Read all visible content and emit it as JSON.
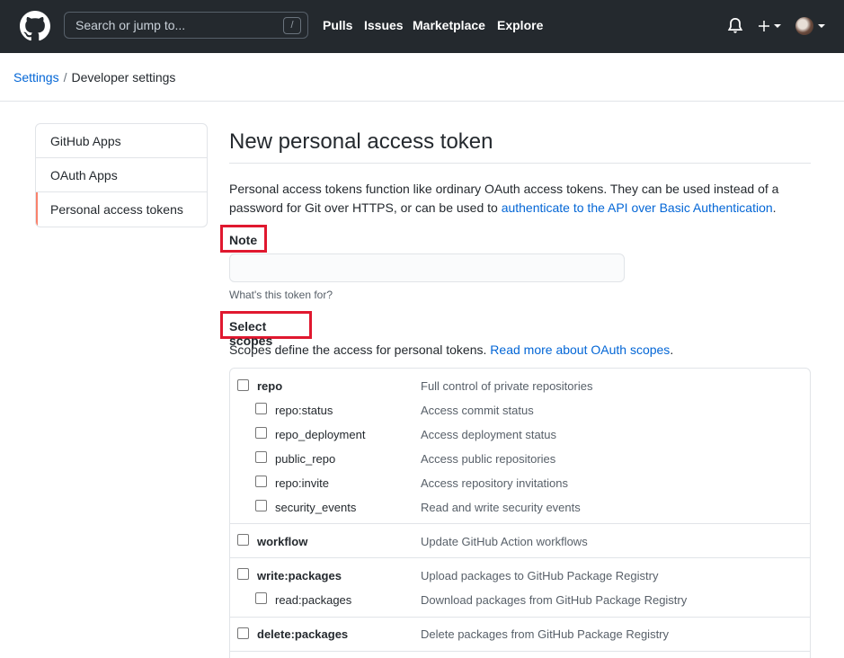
{
  "header": {
    "search_placeholder": "Search or jump to...",
    "search_shortcut": "/",
    "nav": [
      "Pulls",
      "Issues",
      "Marketplace",
      "Explore"
    ],
    "icons": [
      "github-logo-icon",
      "bell-icon",
      "plus-icon",
      "avatar"
    ]
  },
  "breadcrumb": {
    "root": "Settings",
    "separator": "/",
    "current": "Developer settings"
  },
  "sidebar": {
    "items": [
      {
        "label": "GitHub Apps",
        "selected": false
      },
      {
        "label": "OAuth Apps",
        "selected": false
      },
      {
        "label": "Personal access tokens",
        "selected": true
      }
    ]
  },
  "main": {
    "title": "New personal access token",
    "intro_text": "Personal access tokens function like ordinary OAuth access tokens. They can be used instead of a password for Git over HTTPS, or can be used to",
    "intro_link": "authenticate to the API over Basic Authentication",
    "intro_end": ".",
    "note_label": "Note",
    "note_value": "",
    "note_hint": "What's this token for?",
    "scopes_label": "Select scopes",
    "scopes_desc": "Scopes define the access for personal tokens.",
    "scopes_link": "Read more about OAuth scopes",
    "scopes_end": ".",
    "scopes": [
      {
        "name": "repo",
        "desc": "Full control of private repositories",
        "checked": false
      },
      {
        "name": "repo:status",
        "desc": "Access commit status",
        "checked": false
      },
      {
        "name": "repo_deployment",
        "desc": "Access deployment status",
        "checked": false
      },
      {
        "name": "public_repo",
        "desc": "Access public repositories",
        "checked": false
      },
      {
        "name": "repo:invite",
        "desc": "Access repository invitations",
        "checked": false
      },
      {
        "name": "security_events",
        "desc": "Read and write security events",
        "checked": false
      },
      {
        "name": "workflow",
        "desc": "Update GitHub Action workflows",
        "checked": false
      },
      {
        "name": "write:packages",
        "desc": "Upload packages to GitHub Package Registry",
        "checked": false
      },
      {
        "name": "read:packages",
        "desc": "Download packages from GitHub Package Registry",
        "checked": false
      },
      {
        "name": "delete:packages",
        "desc": "Delete packages from GitHub Package Registry",
        "checked": false
      }
    ]
  },
  "colors": {
    "header_bg": "#24292e",
    "link": "#0366d6",
    "highlight_box": "#e0182f",
    "selected_accent": "#f9826c"
  }
}
